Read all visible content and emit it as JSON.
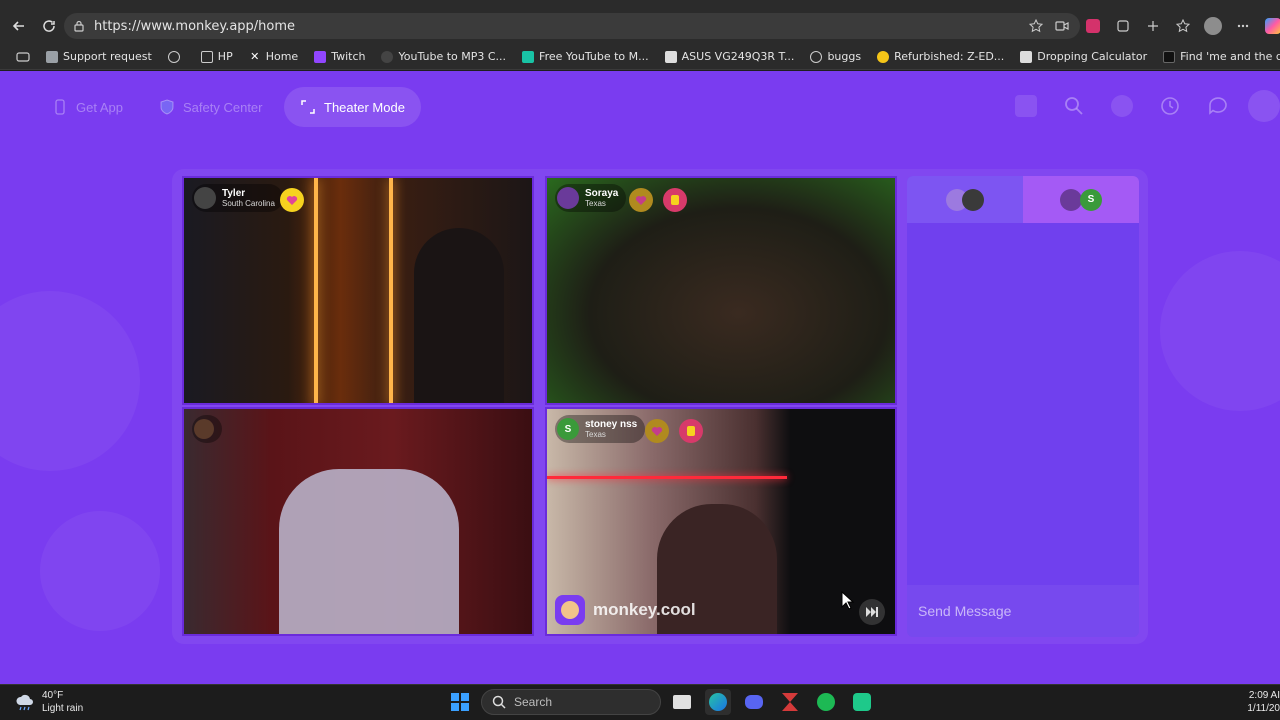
{
  "browser": {
    "url": "https://www.monkey.app/home",
    "bookmarks": [
      {
        "label": "Support request",
        "color": "#9aa0a6"
      },
      {
        "label": "",
        "color": "#9aa0a6"
      },
      {
        "label": "HP",
        "color": "#9aa0a6"
      },
      {
        "label": "Home",
        "color": "#ffffff"
      },
      {
        "label": "Twitch",
        "color": "#9146ff"
      },
      {
        "label": "YouTube to MP3 C...",
        "color": "#333333"
      },
      {
        "label": "Free YouTube to M...",
        "color": "#19c3a5"
      },
      {
        "label": "ASUS VG249Q3R T...",
        "color": "#dddddd"
      },
      {
        "label": "buggs",
        "color": "#9aa0a6"
      },
      {
        "label": "Refurbished: Z-ED...",
        "color": "#f5c518"
      },
      {
        "label": "Dropping Calculator",
        "color": "#dddddd"
      },
      {
        "label": "Find 'me and the d...",
        "color": "#111111"
      }
    ]
  },
  "nav": {
    "get_app": "Get App",
    "safety_center": "Safety Center",
    "theater_mode": "Theater Mode"
  },
  "tiles": [
    {
      "name": "Tyler",
      "location": "South Carolina",
      "heart_color": "#f6d21f"
    },
    {
      "name": "Soraya",
      "location": "Texas",
      "heart_color": "#b08a1f"
    },
    {
      "name": "",
      "location": "",
      "heart_color": ""
    },
    {
      "name": "stoney nss",
      "location": "Texas",
      "heart_color": "#b08a1f",
      "avatar_letter": "S"
    }
  ],
  "watermark": "monkey.cool",
  "chat": {
    "tab2_avatar_letter": "S",
    "send_placeholder": "Send Message"
  },
  "taskbar": {
    "temperature": "40°F",
    "weather": "Light rain",
    "search_placeholder": "Search",
    "time": "2:09 AI",
    "date": "1/11/20"
  }
}
